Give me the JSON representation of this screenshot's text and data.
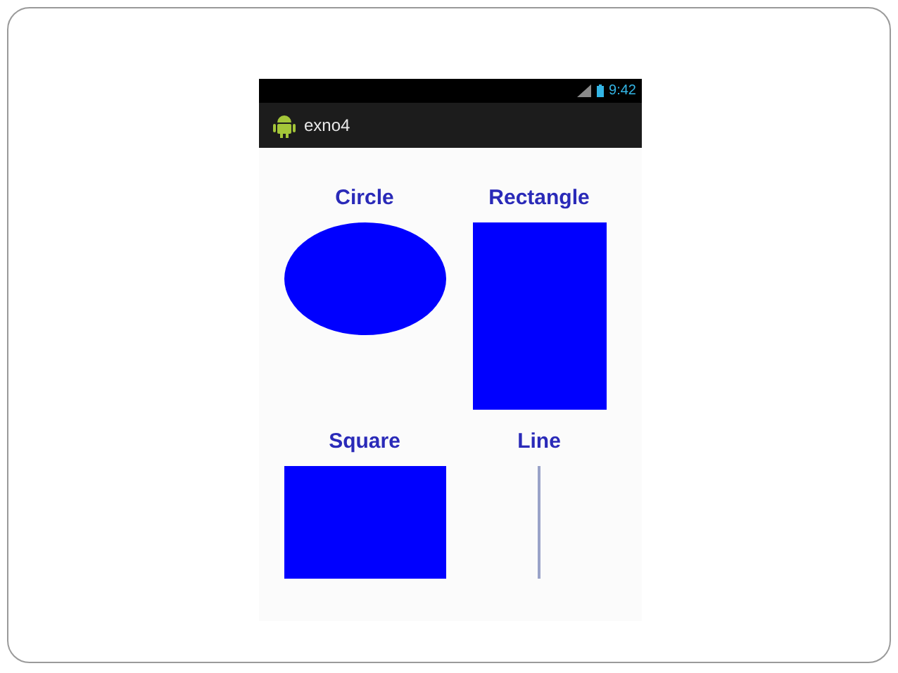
{
  "status_bar": {
    "time": "9:42"
  },
  "app_bar": {
    "title": "exno4"
  },
  "shapes": [
    {
      "label": "Circle",
      "kind": "circle"
    },
    {
      "label": "Rectangle",
      "kind": "rectangle"
    },
    {
      "label": "Square",
      "kind": "square"
    },
    {
      "label": "Line",
      "kind": "line"
    }
  ]
}
